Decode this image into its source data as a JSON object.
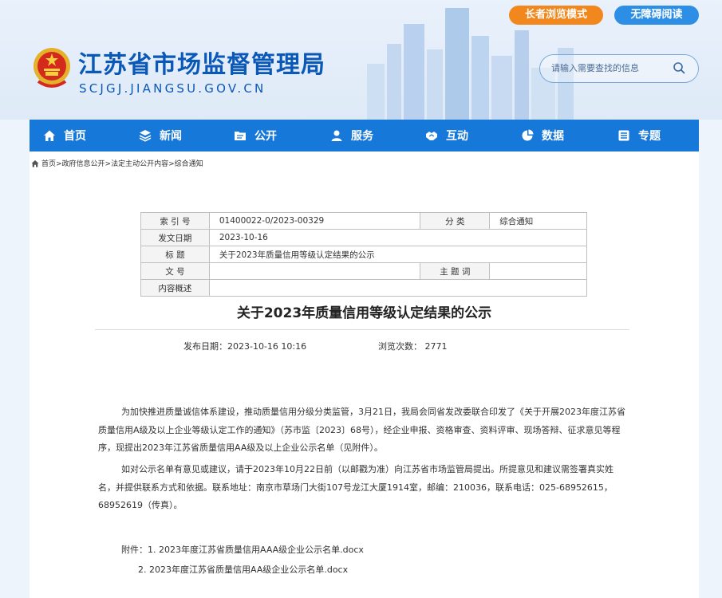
{
  "header": {
    "site_name": "江苏省市场监督管理局",
    "site_domain": "SCJGJ.JIANGSU.GOV.CN",
    "elder_mode_label": "长者浏览模式",
    "accessibility_label": "无障碍阅读",
    "search_placeholder": "请输入需要查找的信息"
  },
  "nav": {
    "items": [
      {
        "label": "首页",
        "icon": "home-icon"
      },
      {
        "label": "新闻",
        "icon": "layers-icon"
      },
      {
        "label": "公开",
        "icon": "folder-icon"
      },
      {
        "label": "服务",
        "icon": "user-service-icon"
      },
      {
        "label": "互动",
        "icon": "handshake-icon"
      },
      {
        "label": "数据",
        "icon": "pie-chart-icon"
      },
      {
        "label": "专题",
        "icon": "list-icon"
      }
    ]
  },
  "breadcrumb": {
    "text": "首页>政府信息公开>法定主动公开内容>综合通知"
  },
  "meta_table": {
    "index_label": "索 引 号",
    "index_value": "01400022-0/2023-00329",
    "category_label": "分 类",
    "category_value": "综合通知",
    "date_label": "发文日期",
    "date_value": "2023-10-16",
    "title_label": "标 题",
    "title_value": "关于2023年质量信用等级认定结果的公示",
    "docno_label": "文 号",
    "docno_value": "",
    "subject_label": "主 题 词",
    "subject_value": "",
    "summary_label": "内容概述",
    "summary_value": ""
  },
  "article": {
    "title": "关于2023年质量信用等级认定结果的公示",
    "publish_info": "发布日期：2023-10-16 10:16",
    "views_info": "浏览次数：  2771",
    "paragraph_1": "为加快推进质量诚信体系建设，推动质量信用分级分类监管，3月21日，我局会同省发改委联合印发了《关于开展2023年度江苏省质量信用A级及以上企业等级认定工作的通知》（苏市监〔2023〕68号），经企业申报、资格审查、资料评审、现场答辩、征求意见等程序，现提出2023年江苏省质量信用AA级及以上企业公示名单（见附件）。",
    "paragraph_2": "如对公示名单有意见或建议，请于2023年10月22日前（以邮戳为准）向江苏省市场监管局提出。所提意见和建议需签署真实姓名，并提供联系方式和依据。联系地址：南京市草场门大街107号龙江大厦1914室，邮编：210036，联系电话：025-68952615，68952619（传真）。",
    "attachment_1": "附件：1. 2023年度江苏省质量信用AAA级企业公示名单.docx",
    "attachment_2": "2. 2023年度江苏省质量信用AA级企业公示名单.docx"
  },
  "colors": {
    "brand_blue": "#0a58b7",
    "nav_blue": "#1678d8",
    "elder_orange": "#f2881d",
    "access_blue": "#2d8ee6"
  }
}
